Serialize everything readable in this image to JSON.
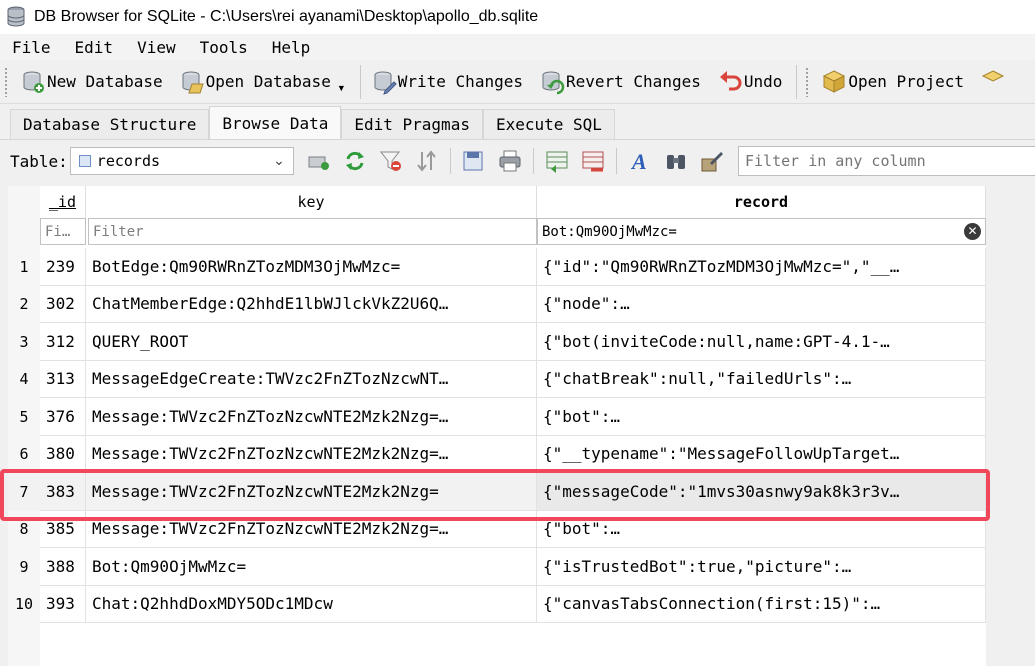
{
  "window": {
    "title": "DB Browser for SQLite - C:\\Users\\rei ayanami\\Desktop\\apollo_db.sqlite"
  },
  "menu": [
    "File",
    "Edit",
    "View",
    "Tools",
    "Help"
  ],
  "toolbar": {
    "new_database": "New Database",
    "open_database": "Open Database",
    "write_changes": "Write Changes",
    "revert_changes": "Revert Changes",
    "undo": "Undo",
    "open_project": "Open Project"
  },
  "tabs": [
    "Database Structure",
    "Browse Data",
    "Edit Pragmas",
    "Execute SQL"
  ],
  "active_tab": "Browse Data",
  "browse": {
    "table_label": "Table:",
    "table_value": "records",
    "filter_any_placeholder": "Filter in any column"
  },
  "grid": {
    "columns": {
      "id": "_id",
      "key": "key",
      "record": "record"
    },
    "filters": {
      "id": "Fi…",
      "key": "Filter",
      "record": "Bot:Qm90OjMwMzc="
    },
    "rows": [
      {
        "n": "1",
        "id": "239",
        "key": "BotEdge:Qm90RWRnZTozMDM3OjMwMzc=",
        "record": "{\"id\":\"Qm90RWRnZTozMDM3OjMwMzc=\",\"__…"
      },
      {
        "n": "2",
        "id": "302",
        "key": "ChatMemberEdge:Q2hhdE1lbWJlckVkZ2U6Q…",
        "record": "{\"node\":…"
      },
      {
        "n": "3",
        "id": "312",
        "key": "QUERY_ROOT",
        "record": "{\"bot(inviteCode:null,name:GPT-4.1-…"
      },
      {
        "n": "4",
        "id": "313",
        "key": "MessageEdgeCreate:TWVzc2FnZTozNzcwNT…",
        "record": "{\"chatBreak\":null,\"failedUrls\":…"
      },
      {
        "n": "5",
        "id": "376",
        "key": "Message:TWVzc2FnZTozNzcwNTE2Mzk2Nzg=…",
        "record": "{\"bot\":…"
      },
      {
        "n": "6",
        "id": "380",
        "key": "Message:TWVzc2FnZTozNzcwNTE2Mzk2Nzg=…",
        "record": "{\"__typename\":\"MessageFollowUpTarget…"
      },
      {
        "n": "7",
        "id": "383",
        "key": "Message:TWVzc2FnZTozNzcwNTE2Mzk2Nzg=",
        "record": "{\"messageCode\":\"1mvs30asnwy9ak8k3r3v…"
      },
      {
        "n": "8",
        "id": "385",
        "key": "Message:TWVzc2FnZTozNzcwNTE2Mzk2Nzg=…",
        "record": "{\"bot\":…"
      },
      {
        "n": "9",
        "id": "388",
        "key": "Bot:Qm90OjMwMzc=",
        "record": "{\"isTrustedBot\":true,\"picture\":…"
      },
      {
        "n": "10",
        "id": "393",
        "key": "Chat:Q2hhdDoxMDY5ODc1MDcw",
        "record": "{\"canvasTabsConnection(first:15)\":…"
      }
    ]
  }
}
